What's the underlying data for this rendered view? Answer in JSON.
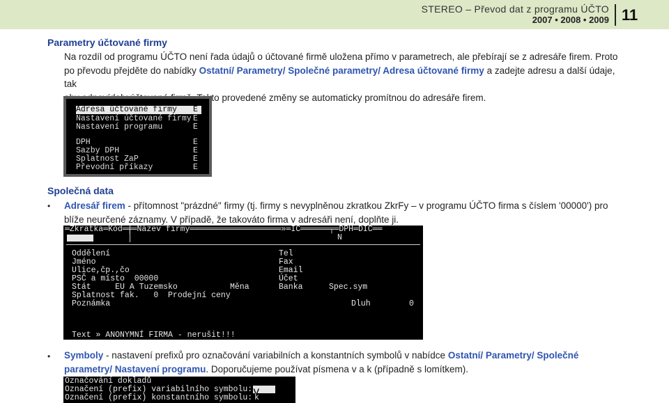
{
  "header": {
    "title": "STEREO – Převod dat z programu ÚČTO",
    "years": "2007  •  2008  •  2009",
    "page_number": "11"
  },
  "section1": {
    "heading": "Parametry účtované firmy",
    "p1": "Na rozdíl od programu ÚČTO není řada údajů o účtované firmě uložena přímo v parametrech, ale přebírají se z adresáře firem. Proto",
    "p2_pre": "po převodu přejděte do nabídky ",
    "p2_link": "Ostatní/ Parametry/ Společné parametry/ Adresa účtované firmy",
    "p2_post": " a zadejte adresu a další údaje, tak",
    "p3": "aby odpovídaly účtované firmě. Takto provedené změny se automaticky promítnou do adresáře firem."
  },
  "menu_screen": {
    "items": [
      {
        "label": "Adresa účtované firmy",
        "key": "E"
      },
      {
        "label": "Nastavení účtované firmy",
        "key": "E"
      },
      {
        "label": "Nastavení programu",
        "key": "E"
      },
      {
        "label": "DPH",
        "key": "E"
      },
      {
        "label": "Sazby DPH",
        "key": "E"
      },
      {
        "label": "Splatnost ZaP",
        "key": "E"
      },
      {
        "label": "Převodní příkazy",
        "key": "E"
      }
    ]
  },
  "section2": {
    "heading": "Společná data",
    "b1_link": "Adresář firem",
    "b1_text": " - přítomnost \"prázdné\" firmy (tj. firmy s nevyplněnou zkratkou ZkrFy – v programu ÚČTO firma s číslem '00000') pro",
    "b1_line2": "blíže neurčené záznamy. V případě, že takováto firma v adresáři není, doplňte ji."
  },
  "address_screen": {
    "top_bar": "═Zkratka═Kód═╤═Název firmy═══════════════════»═IČ══════╤═DPH═DIČ══",
    "dph_value": "N",
    "left_labels": [
      "Oddělení",
      "Jméno",
      "Ulice,čp.,čo",
      "PSČ a místo  00000",
      "Stát     EU A Tuzemsko",
      "Splatnost fak.   0  Prodejní ceny",
      "Poznámka"
    ],
    "right_labels": [
      "Tel",
      "Fax",
      "Email",
      "Účet",
      "Banka"
    ],
    "mena_label": "Měna",
    "spec_label": "Spec.sym",
    "dluh_label": "Dluh",
    "dluh_value": "0",
    "bottom_text": "Text » ANONYMNÍ FIRMA - nerušit!!!"
  },
  "section3": {
    "b2_link": "Symboly",
    "b2_text": " - nastavení prefixů pro označování variabilních a konstantních symbolů v nabídce ",
    "b2_link2": "Ostatní/ Parametry/ Společné",
    "b2_link3": "parametry/ Nastavení programu",
    "b2_text2": ". Doporučujeme používat písmena v a k (případně s lomítkem)."
  },
  "symbols_screen": {
    "title": "Označování dokladů",
    "row1": "Označení (prefix) variabilního symbolu:",
    "row1_val": "v",
    "row2": "Označení (prefix) konstantního symbolu:",
    "row2_val": "k"
  }
}
